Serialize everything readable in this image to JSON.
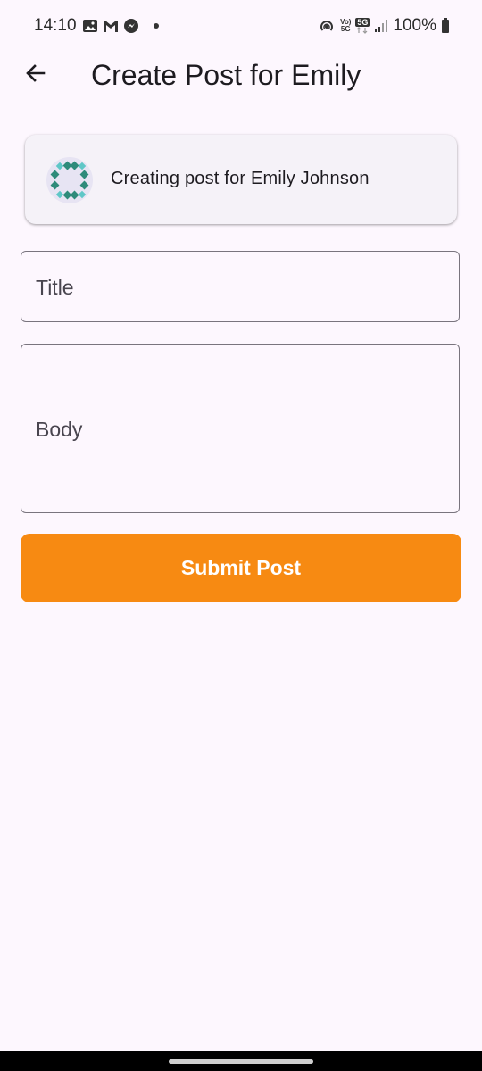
{
  "status_bar": {
    "time": "14:10",
    "battery": "100%",
    "network_label": "5G",
    "volte_label": "Vo)",
    "volte_sub": "5G"
  },
  "app_bar": {
    "title": "Create Post for Emily"
  },
  "info_card": {
    "text": "Creating post for Emily Johnson"
  },
  "form": {
    "title_placeholder": "Title",
    "body_placeholder": "Body"
  },
  "actions": {
    "submit_label": "Submit Post"
  },
  "colors": {
    "background": "#fdf7fe",
    "accent": "#f78a12",
    "card": "#f5f2f8",
    "avatar_primary": "#2e8b7a",
    "avatar_secondary": "#5fc7c7"
  },
  "icons": {
    "back": "arrow-left-icon",
    "avatar": "geometric-avatar-icon"
  }
}
